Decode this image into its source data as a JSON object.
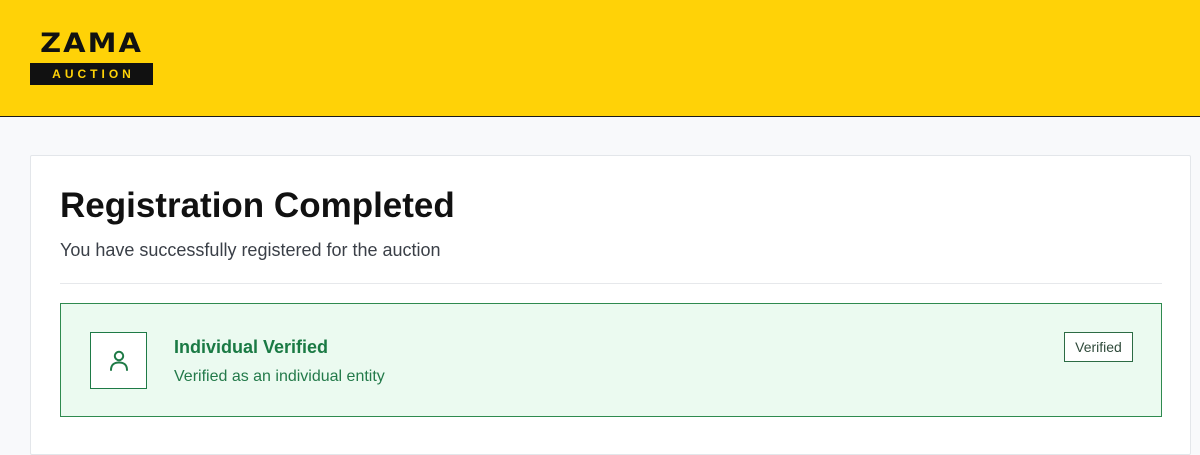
{
  "header": {
    "logo_word": "ZAMA",
    "logo_sub": "AUCTION",
    "brand_color": "#ffd207"
  },
  "main": {
    "title": "Registration Completed",
    "subtitle": "You have successfully registered for the auction",
    "verification": {
      "icon": "user-icon",
      "title": "Individual Verified",
      "description": "Verified as an individual entity",
      "badge": "Verified",
      "accent_color": "#1a7a44",
      "background_color": "#ebfaf0"
    }
  }
}
